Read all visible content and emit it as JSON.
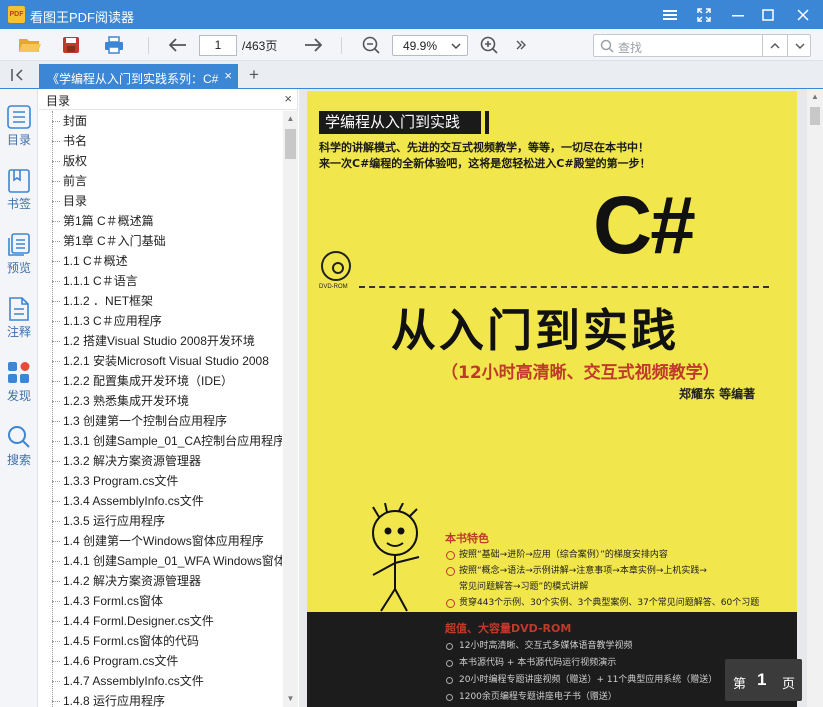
{
  "app": {
    "title": "看图王PDF阅读器",
    "logo_text": "PDF"
  },
  "toolbar": {
    "page_current": "1",
    "page_total": "/463页",
    "zoom": "49.9%",
    "search_placeholder": "查找"
  },
  "tab": {
    "title": "《学编程从入门到实践系列：C#",
    "close": "×",
    "add": "+"
  },
  "rail": {
    "items": [
      {
        "label": "目录",
        "icon": "toc-icon"
      },
      {
        "label": "书签",
        "icon": "bookmark-icon"
      },
      {
        "label": "预览",
        "icon": "preview-icon"
      },
      {
        "label": "注释",
        "icon": "annotation-icon"
      },
      {
        "label": "发现",
        "icon": "discover-icon"
      },
      {
        "label": "搜索",
        "icon": "search-icon"
      }
    ]
  },
  "toc": {
    "title": "目录",
    "close": "×",
    "items": [
      "封面",
      "书名",
      "版权",
      "前言",
      "目录",
      "第1篇 C＃概述篇",
      "第1章 C＃入门基础",
      "1.1 C＃概述",
      "1.1.1 C＃语言",
      "1.1.2 ．NET框架",
      "1.1.3 C＃应用程序",
      "1.2 搭建Visual Studio 2008开发环境",
      "1.2.1 安装Microsoft Visual Studio 2008",
      "1.2.2 配置集成开发环境（IDE）",
      "1.2.3 熟悉集成开发环境",
      "1.3 创建第一个控制台应用程序",
      "1.3.1 创建Sample_01_CA控制台应用程序",
      "1.3.2 解决方案资源管理器",
      "1.3.3 Program.cs文件",
      "1.3.4 AssemblyInfo.cs文件",
      "1.3.5 运行应用程序",
      "1.4 创建第一个Windows窗体应用程序",
      "1.4.1 创建Sample_01_WFA Windows窗体",
      "1.4.2 解决方案资源管理器",
      "1.4.3 Forml.cs窗体",
      "1.4.4 Forml.Designer.cs文件",
      "1.4.5 Forml.cs窗体的代码",
      "1.4.6 Program.cs文件",
      "1.4.7 AssemblyInfo.cs文件",
      "1.4.8 运行应用程序"
    ]
  },
  "cover": {
    "banner": "学编程从入门到实践",
    "intro_line1": "科学的讲解模式、先进的交互式视频教学，等等，一切尽在本书中！",
    "intro_line2": "来一次C#编程的全新体验吧，这将是您轻松进入C#殿堂的第一步！",
    "big_title": "C#",
    "disc_label": "DVD-ROM",
    "title": "从入门到实践",
    "subtitle": "（12小时高清晰、交互式视频教学）",
    "author": "郑耀东  等编著",
    "feature_title": "本书特色",
    "features": [
      "按照“基础→进阶→应用（综合案例）”的梯度安排内容",
      "按照“概念→语法→示例讲解→注意事项→本章实例→上机实践→",
      "常见问题解答→习题”的模式讲解",
      "贯穿443个示例、30个实例、3个典型案例、37个常见问题解答、60个习题"
    ],
    "dvd_title": "超值、大容量DVD-ROM",
    "dvd_items": [
      "12小时高清晰、交互式多媒体语音教学视频",
      "本书源代码 + 本书源代码运行视频演示",
      "20小时编程专题讲座视频（赠送）+ 11个典型应用系统（赠送）",
      "1200余页编程专题讲座电子书（赠送）"
    ]
  },
  "pager": {
    "prefix": "第",
    "number": "1",
    "suffix": "页"
  },
  "colors": {
    "accent": "#3c86d6",
    "cover_yellow": "#f1e74d",
    "cover_red": "#c03a2b"
  }
}
